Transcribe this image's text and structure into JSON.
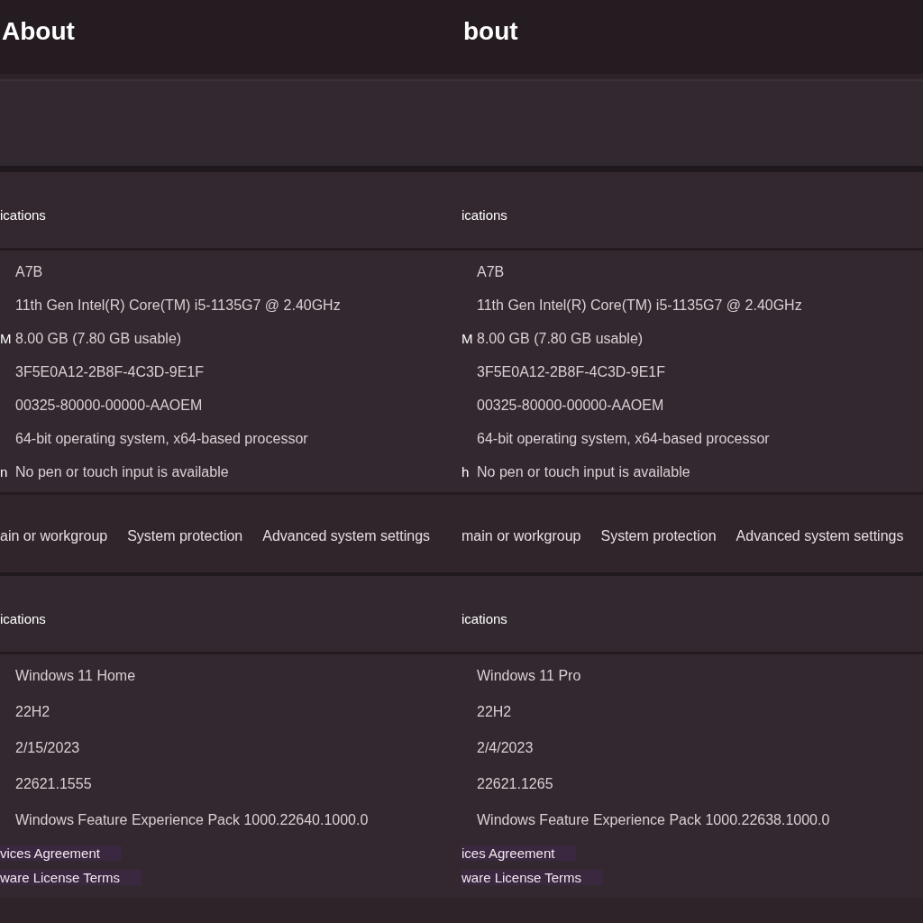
{
  "panes": [
    {
      "title": "About",
      "device_specs": {
        "heading": "ications",
        "rows": [
          {
            "value": "A7B"
          },
          {
            "value": "11th Gen Intel(R) Core(TM) i5-1135G7 @ 2.40GHz"
          },
          {
            "label": "M",
            "value": "8.00 GB (7.80 GB usable)"
          },
          {
            "value": "3F5E0A12-2B8F-4C3D-9E1F"
          },
          {
            "value": "00325-80000-00000-AAOEM"
          },
          {
            "value": "64-bit operating system, x64-based processor"
          },
          {
            "label": "n",
            "value": "No pen or touch input is available"
          }
        ]
      },
      "related_links": [
        "ain or workgroup",
        "System protection",
        "Advanced system settings"
      ],
      "windows_specs": {
        "heading": "ications",
        "rows": [
          {
            "value": "Windows 11 Home"
          },
          {
            "value": "22H2"
          },
          {
            "value": "2/15/2023"
          },
          {
            "value": "22621.1555"
          },
          {
            "value": "Windows Feature Experience Pack 1000.22640.1000.0"
          }
        ]
      },
      "footer_links": [
        "vices Agreement",
        "ware License Terms"
      ]
    },
    {
      "title": "bout",
      "device_specs": {
        "heading": "ications",
        "rows": [
          {
            "value": "A7B"
          },
          {
            "value": "11th Gen Intel(R) Core(TM) i5-1135G7 @ 2.40GHz"
          },
          {
            "label": "M",
            "value": "8.00 GB (7.80 GB usable)"
          },
          {
            "value": "3F5E0A12-2B8F-4C3D-9E1F"
          },
          {
            "value": "00325-80000-00000-AAOEM"
          },
          {
            "value": "64-bit operating system, x64-based processor"
          },
          {
            "label": "h",
            "value": "No pen or touch input is available"
          }
        ]
      },
      "related_links": [
        "main or workgroup",
        "System protection",
        "Advanced system settings"
      ],
      "windows_specs": {
        "heading": "ications",
        "rows": [
          {
            "value": "Windows 11 Pro"
          },
          {
            "value": "22H2"
          },
          {
            "value": "2/4/2023"
          },
          {
            "value": "22621.1265"
          },
          {
            "value": "Windows Feature Experience Pack 1000.22638.1000.0"
          }
        ]
      },
      "footer_links": [
        "ices Agreement",
        "ware License Terms"
      ]
    }
  ]
}
